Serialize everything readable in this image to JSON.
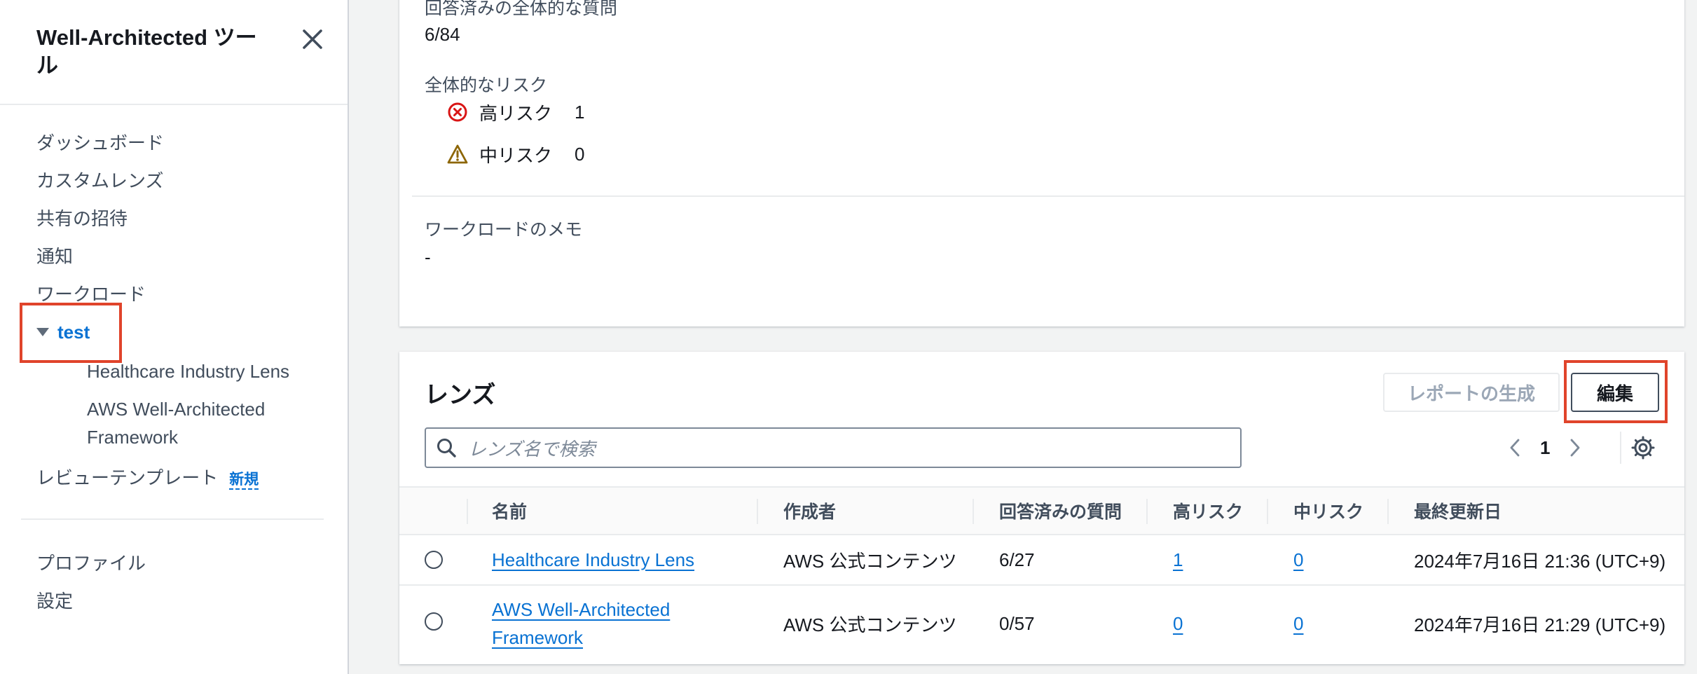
{
  "sidebar": {
    "title": "Well-Architected ツール",
    "nav": {
      "dashboard": "ダッシュボード",
      "custom_lenses": "カスタムレンズ",
      "shared_invitations": "共有の招待",
      "notifications": "通知",
      "workloads": "ワークロード",
      "workload_test": "test",
      "lens_healthcare": "Healthcare Industry Lens",
      "lens_wa_framework": "AWS Well-Architected Framework",
      "review_templates": "レビューテンプレート",
      "new_badge": "新規",
      "profile": "プロファイル",
      "settings": "設定"
    }
  },
  "overview": {
    "answered_label": "回答済みの全体的な質問",
    "answered_value": "6/84",
    "overall_risk_label": "全体的なリスク",
    "high_risk_label": "高リスク",
    "high_risk_value": "1",
    "medium_risk_label": "中リスク",
    "medium_risk_value": "0",
    "notes_label": "ワークロードのメモ",
    "notes_value": "-"
  },
  "lenses": {
    "title": "レンズ",
    "generate_report_label": "レポートの生成",
    "edit_label": "編集",
    "search_placeholder": "レンズ名で検索",
    "page_number": "1",
    "columns": {
      "name": "名前",
      "owner": "作成者",
      "answered": "回答済みの質問",
      "high_risk": "高リスク",
      "medium_risk": "中リスク",
      "last_updated": "最終更新日"
    },
    "rows": [
      {
        "name": "Healthcare Industry Lens",
        "owner": "AWS 公式コンテンツ",
        "answered": "6/27",
        "high_risk": "1",
        "medium_risk": "0",
        "last_updated": "2024年7月16日 21:36 (UTC+9)"
      },
      {
        "name": "AWS Well-Architected Framework",
        "owner": "AWS 公式コンテンツ",
        "answered": "0/57",
        "high_risk": "0",
        "medium_risk": "0",
        "last_updated": "2024年7月16日 21:29 (UTC+9)"
      }
    ]
  },
  "colors": {
    "link": "#0972d3",
    "high_risk_icon": "#d91515",
    "medium_risk_icon": "#8d6605",
    "highlight_box": "#e0442b"
  },
  "icons": {
    "close": "close-icon",
    "expand": "caret-down-icon",
    "high_risk": "status-negative-icon",
    "medium_risk": "status-warning-icon",
    "search": "search-icon",
    "prev": "chevron-left-icon",
    "next": "chevron-right-icon",
    "settings": "gear-icon"
  }
}
